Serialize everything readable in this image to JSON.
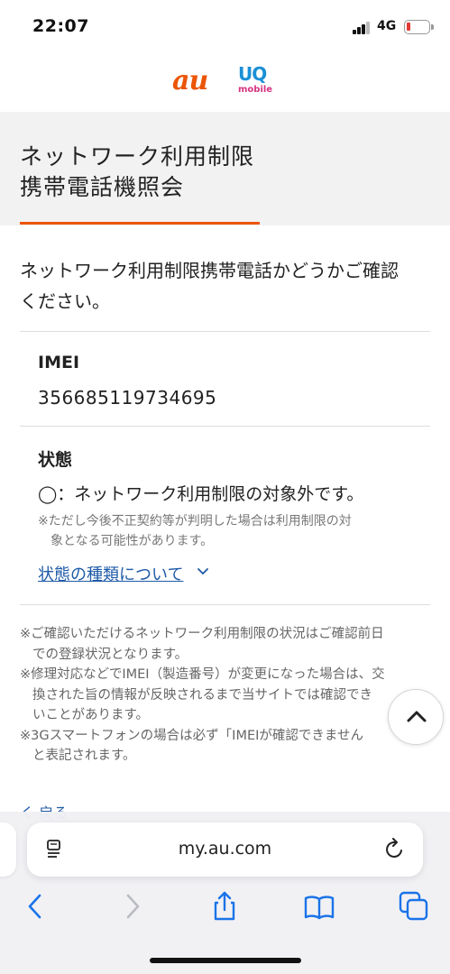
{
  "status_bar": {
    "time": "22:07",
    "network": "4G",
    "battery_color": "#e53935"
  },
  "header": {
    "logo_au": "au",
    "logo_uq": "UQ",
    "logo_uq_sub": "mobile",
    "brand_color": "#eb5505"
  },
  "title": {
    "line1": "ネットワーク利用制限",
    "line2": "携帯電話機照会"
  },
  "intro": {
    "line1": "ネットワーク利用制限携帯電話かどうかご確認",
    "line2": "ください。"
  },
  "imei": {
    "label": "IMEI",
    "value": "356685119734695"
  },
  "status": {
    "label": "状態",
    "value": "◯：ネットワーク利用制限の対象外です。",
    "note_line1": "※ただし今後不正契約等が判明した場合は利用制限の対",
    "note_line2": "象となる可能性があります。",
    "link": "状態の種類について"
  },
  "footnotes": {
    "n1_line1": "※ご確認いただけるネットワーク利用制限の状況はご確認前日",
    "n1_line2": "での登録状況となります。",
    "n2_line1": "※修理対応などでIMEI（製造番号）が変更になった場合は、交",
    "n2_line2": "換された旨の情報が反映されるまで当サイトでは確認でき",
    "n2_line3": "いことがあります。",
    "n3_line1": "※3Gスマートフォンの場合は必ず「IMEIが確認できません",
    "n3_line2": "と表記されます。"
  },
  "back_link": "く 戻る",
  "browser": {
    "url": "my.au.com"
  }
}
